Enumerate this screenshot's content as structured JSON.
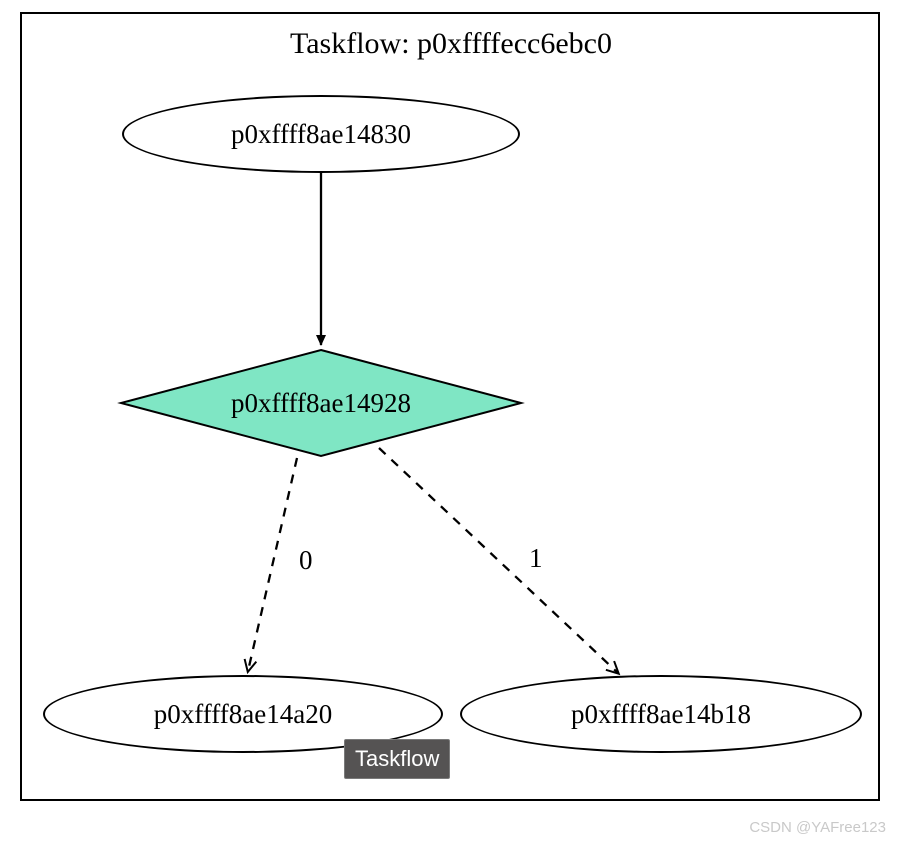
{
  "title": "Taskflow: p0xffffecc6ebc0",
  "nodes": {
    "n1": "p0xffff8ae14830",
    "n2": "p0xffff8ae14928",
    "n3": "p0xffff8ae14a20",
    "n4": "p0xffff8ae14b18"
  },
  "edges": {
    "e1": {
      "from": "n1",
      "to": "n2",
      "label": "",
      "style": "solid"
    },
    "e2": {
      "from": "n2",
      "to": "n3",
      "label": "0",
      "style": "dashed"
    },
    "e3": {
      "from": "n2",
      "to": "n4",
      "label": "1",
      "style": "dashed"
    }
  },
  "tooltip": "Taskflow",
  "watermark": "CSDN @YAFree123",
  "colors": {
    "diamond_fill": "#7fe6c4",
    "border": "#000000"
  }
}
